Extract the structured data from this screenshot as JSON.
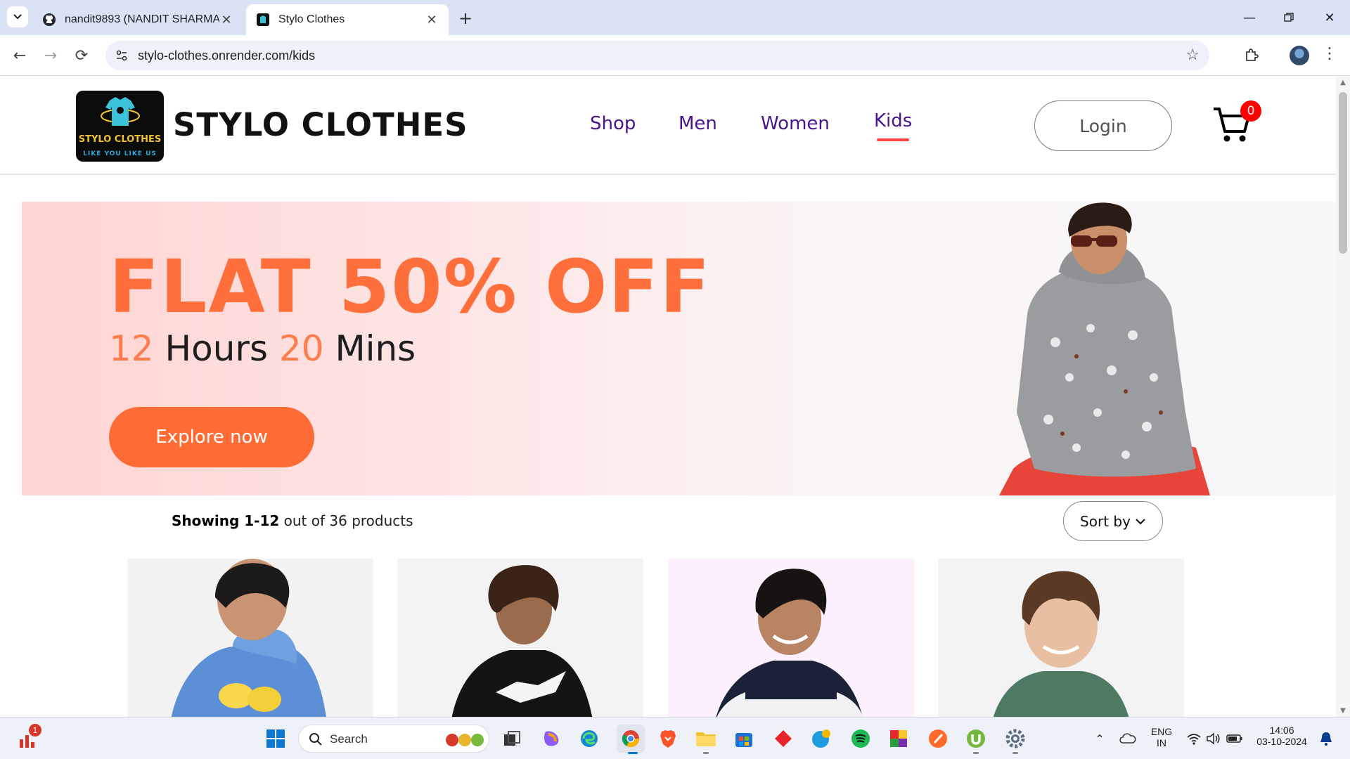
{
  "browser": {
    "tabs": [
      {
        "title": "nandit9893 (NANDIT SHARMA)",
        "icon": "github-icon"
      },
      {
        "title": "Stylo Clothes",
        "icon": "stylo-favicon"
      }
    ],
    "url": "stylo-clothes.onrender.com/kids"
  },
  "site": {
    "logo": {
      "line1": "STYLO CLOTHES",
      "line2": "LIKE YOU LIKE US"
    },
    "brand": "STYLO CLOTHES",
    "nav": [
      {
        "label": "Shop"
      },
      {
        "label": "Men"
      },
      {
        "label": "Women"
      },
      {
        "label": "Kids",
        "active": true
      }
    ],
    "login_label": "Login",
    "cart_count": "0",
    "accent": "#ff4141",
    "nav_color": "#4a148c"
  },
  "hero": {
    "title": "FLAT 50% OFF",
    "hours_num": "12",
    "hours_word": "Hours",
    "mins_num": "20",
    "mins_word": "Mins",
    "button": "Explore now",
    "button_color": "#ff6b35"
  },
  "listing": {
    "showing_bold": "Showing 1-12",
    "showing_rest": "out of 36 products",
    "sort_label": "Sort by"
  },
  "products": [
    {
      "image": "kid-blue-hoodie-lemon-print",
      "bg": "#f2f2f2"
    },
    {
      "image": "kid-black-hoodie",
      "bg": "#f3f3f3"
    },
    {
      "image": "kid-navy-white-hoodie",
      "bg": "#fbf0fb"
    },
    {
      "image": "kid-green-sweatshirt",
      "bg": "#f3f3f3"
    }
  ],
  "taskbar": {
    "search_label": "Search",
    "notification_badge": "1",
    "lang_line1": "ENG",
    "lang_line2": "IN",
    "time": "14:06",
    "date": "03-10-2024"
  }
}
